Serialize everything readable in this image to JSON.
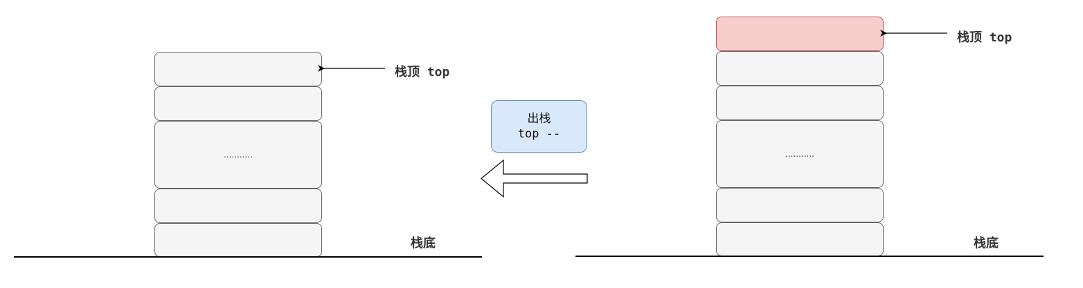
{
  "left_stack": {
    "top_label": "栈顶 top",
    "bottom_label": "栈底",
    "middle_cell_text": "..........."
  },
  "operation": {
    "title": "出栈",
    "subtitle": "top --"
  },
  "right_stack": {
    "top_label": "栈顶 top",
    "bottom_label": "栈底",
    "middle_cell_text": "..........."
  },
  "colors": {
    "cell_fill": "#f5f5f5",
    "cell_border": "#666666",
    "popped_cell_fill": "#f8cecc",
    "popped_cell_border": "#b85450",
    "operation_fill": "#dae8fc",
    "operation_border": "#6c8ebf"
  }
}
